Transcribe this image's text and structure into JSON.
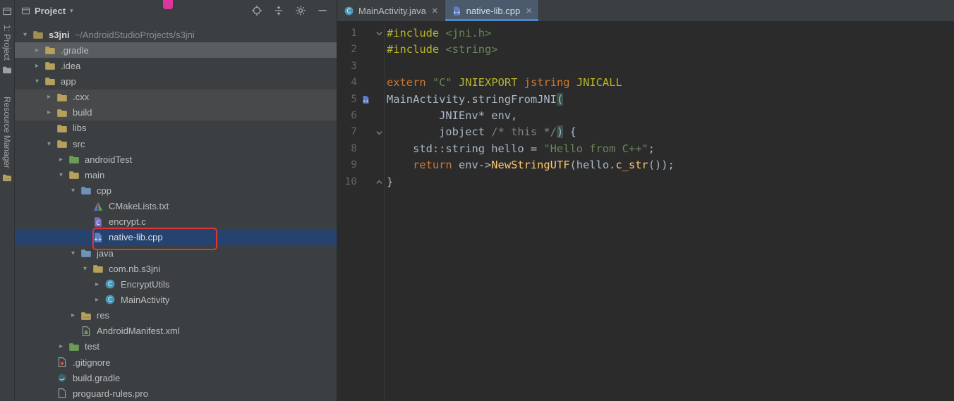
{
  "activity_bar": {
    "top_label": "1: Project",
    "bottom_label": "Resource Manager"
  },
  "project_panel": {
    "title": "Project",
    "caret_glyph": "▾",
    "header_icons": [
      {
        "name": "locate"
      },
      {
        "name": "collapse-all"
      },
      {
        "name": "settings"
      },
      {
        "name": "hide"
      }
    ],
    "tree": [
      {
        "label": "s3jni",
        "suffix": "~/AndroidStudioProjects/s3jni",
        "level": 0,
        "chevron": "expanded",
        "icon": "folder-root",
        "bold": true
      },
      {
        "label": ".gradle",
        "level": 1,
        "chevron": "collapsed",
        "icon": "folder",
        "hover": true
      },
      {
        "label": ".idea",
        "level": 1,
        "chevron": "collapsed",
        "icon": "folder"
      },
      {
        "label": "app",
        "level": 1,
        "chevron": "expanded",
        "icon": "folder-app"
      },
      {
        "label": ".cxx",
        "level": 2,
        "chevron": "collapsed",
        "icon": "folder",
        "band": true
      },
      {
        "label": "build",
        "level": 2,
        "chevron": "collapsed",
        "icon": "folder",
        "band": true
      },
      {
        "label": "libs",
        "level": 2,
        "chevron": null,
        "icon": "folder"
      },
      {
        "label": "src",
        "level": 2,
        "chevron": "expanded",
        "icon": "folder"
      },
      {
        "label": "androidTest",
        "level": 3,
        "chevron": "collapsed",
        "icon": "folder-test"
      },
      {
        "label": "main",
        "level": 3,
        "chevron": "expanded",
        "icon": "folder"
      },
      {
        "label": "cpp",
        "level": 4,
        "chevron": "expanded",
        "icon": "folder-source"
      },
      {
        "label": "CMakeLists.txt",
        "level": 5,
        "chevron": null,
        "icon": "cmake"
      },
      {
        "label": "encrypt.c",
        "level": 5,
        "chevron": null,
        "icon": "c-file"
      },
      {
        "label": "native-lib.cpp",
        "level": 5,
        "chevron": null,
        "icon": "cpp-file",
        "selected": true
      },
      {
        "label": "java",
        "level": 4,
        "chevron": "expanded",
        "icon": "folder-source"
      },
      {
        "label": "com.nb.s3jni",
        "level": 5,
        "chevron": "expanded",
        "icon": "package"
      },
      {
        "label": "EncryptUtils",
        "level": 6,
        "chevron": "collapsed",
        "icon": "class"
      },
      {
        "label": "MainActivity",
        "level": 6,
        "chevron": "collapsed",
        "icon": "class"
      },
      {
        "label": "res",
        "level": 4,
        "chevron": "collapsed",
        "icon": "folder-res"
      },
      {
        "label": "AndroidManifest.xml",
        "level": 4,
        "chevron": null,
        "icon": "manifest"
      },
      {
        "label": "test",
        "level": 3,
        "chevron": "collapsed",
        "icon": "folder-test"
      },
      {
        "label": ".gitignore",
        "level": 2,
        "chevron": null,
        "icon": "gitignore"
      },
      {
        "label": "build.gradle",
        "level": 2,
        "chevron": null,
        "icon": "gradle"
      },
      {
        "label": "proguard-rules.pro",
        "level": 2,
        "chevron": null,
        "icon": "file"
      }
    ]
  },
  "editor": {
    "tabs": [
      {
        "label": "MainActivity.java",
        "icon": "class",
        "active": false
      },
      {
        "label": "native-lib.cpp",
        "icon": "cpp-file",
        "active": true
      }
    ],
    "close_glyph": "×",
    "lines": [
      {
        "num": "1",
        "fold": "open",
        "tokens": [
          [
            "p",
            "#include"
          ],
          [
            "d",
            " "
          ],
          [
            "s",
            "<jni.h>"
          ]
        ]
      },
      {
        "num": "2",
        "tokens": [
          [
            "p",
            "#include"
          ],
          [
            "d",
            " "
          ],
          [
            "s",
            "<string>"
          ]
        ]
      },
      {
        "num": "3",
        "tokens": []
      },
      {
        "num": "4",
        "tokens": [
          [
            "k",
            "extern"
          ],
          [
            "d",
            " "
          ],
          [
            "s",
            "\"C\""
          ],
          [
            "d",
            " "
          ],
          [
            "p",
            "JNIEXPORT"
          ],
          [
            "d",
            " "
          ],
          [
            "k",
            "jstring"
          ],
          [
            "d",
            " "
          ],
          [
            "p",
            "JNICALL"
          ]
        ]
      },
      {
        "num": "5",
        "gicon": "cpp-file",
        "tokens": [
          [
            "d",
            "MainActivity.stringFromJNI"
          ],
          [
            "m",
            "("
          ]
        ]
      },
      {
        "num": "6",
        "tokens": [
          [
            "d",
            "        JNIEnv* env,"
          ]
        ]
      },
      {
        "num": "7",
        "fold": "open",
        "tokens": [
          [
            "d",
            "        jobject "
          ],
          [
            "c",
            "/* this */"
          ],
          [
            "m",
            ")"
          ],
          [
            "d",
            " {"
          ]
        ]
      },
      {
        "num": "8",
        "tokens": [
          [
            "d",
            "    std::string hello = "
          ],
          [
            "s",
            "\"Hello from C++\""
          ],
          [
            "d",
            ";"
          ]
        ]
      },
      {
        "num": "9",
        "tokens": [
          [
            "k",
            "    return "
          ],
          [
            "d",
            "env->"
          ],
          [
            "f",
            "NewStringUTF"
          ],
          [
            "d",
            "(hello."
          ],
          [
            "f",
            "c_str"
          ],
          [
            "d",
            "());"
          ]
        ]
      },
      {
        "num": "10",
        "fold": "close",
        "tokens": [
          [
            "d",
            "}"
          ]
        ]
      }
    ]
  },
  "colors": {
    "editor_bg": "#2b2b2b",
    "panel_bg": "#3c3f41",
    "selection_bg": "#26436f",
    "hover_bg": "#595d5f",
    "band_bg": "#47494b",
    "tab_active_bg": "#4c5a6e",
    "tab_underline": "#4a88c7",
    "annotation_red": "#e13434",
    "keyword": "#cc7832",
    "preprocessor": "#bbb529",
    "string": "#6a8759",
    "comment": "#808080",
    "function_call": "#ffc66d",
    "default_text": "#a9b7c6",
    "line_number": "#606366"
  }
}
